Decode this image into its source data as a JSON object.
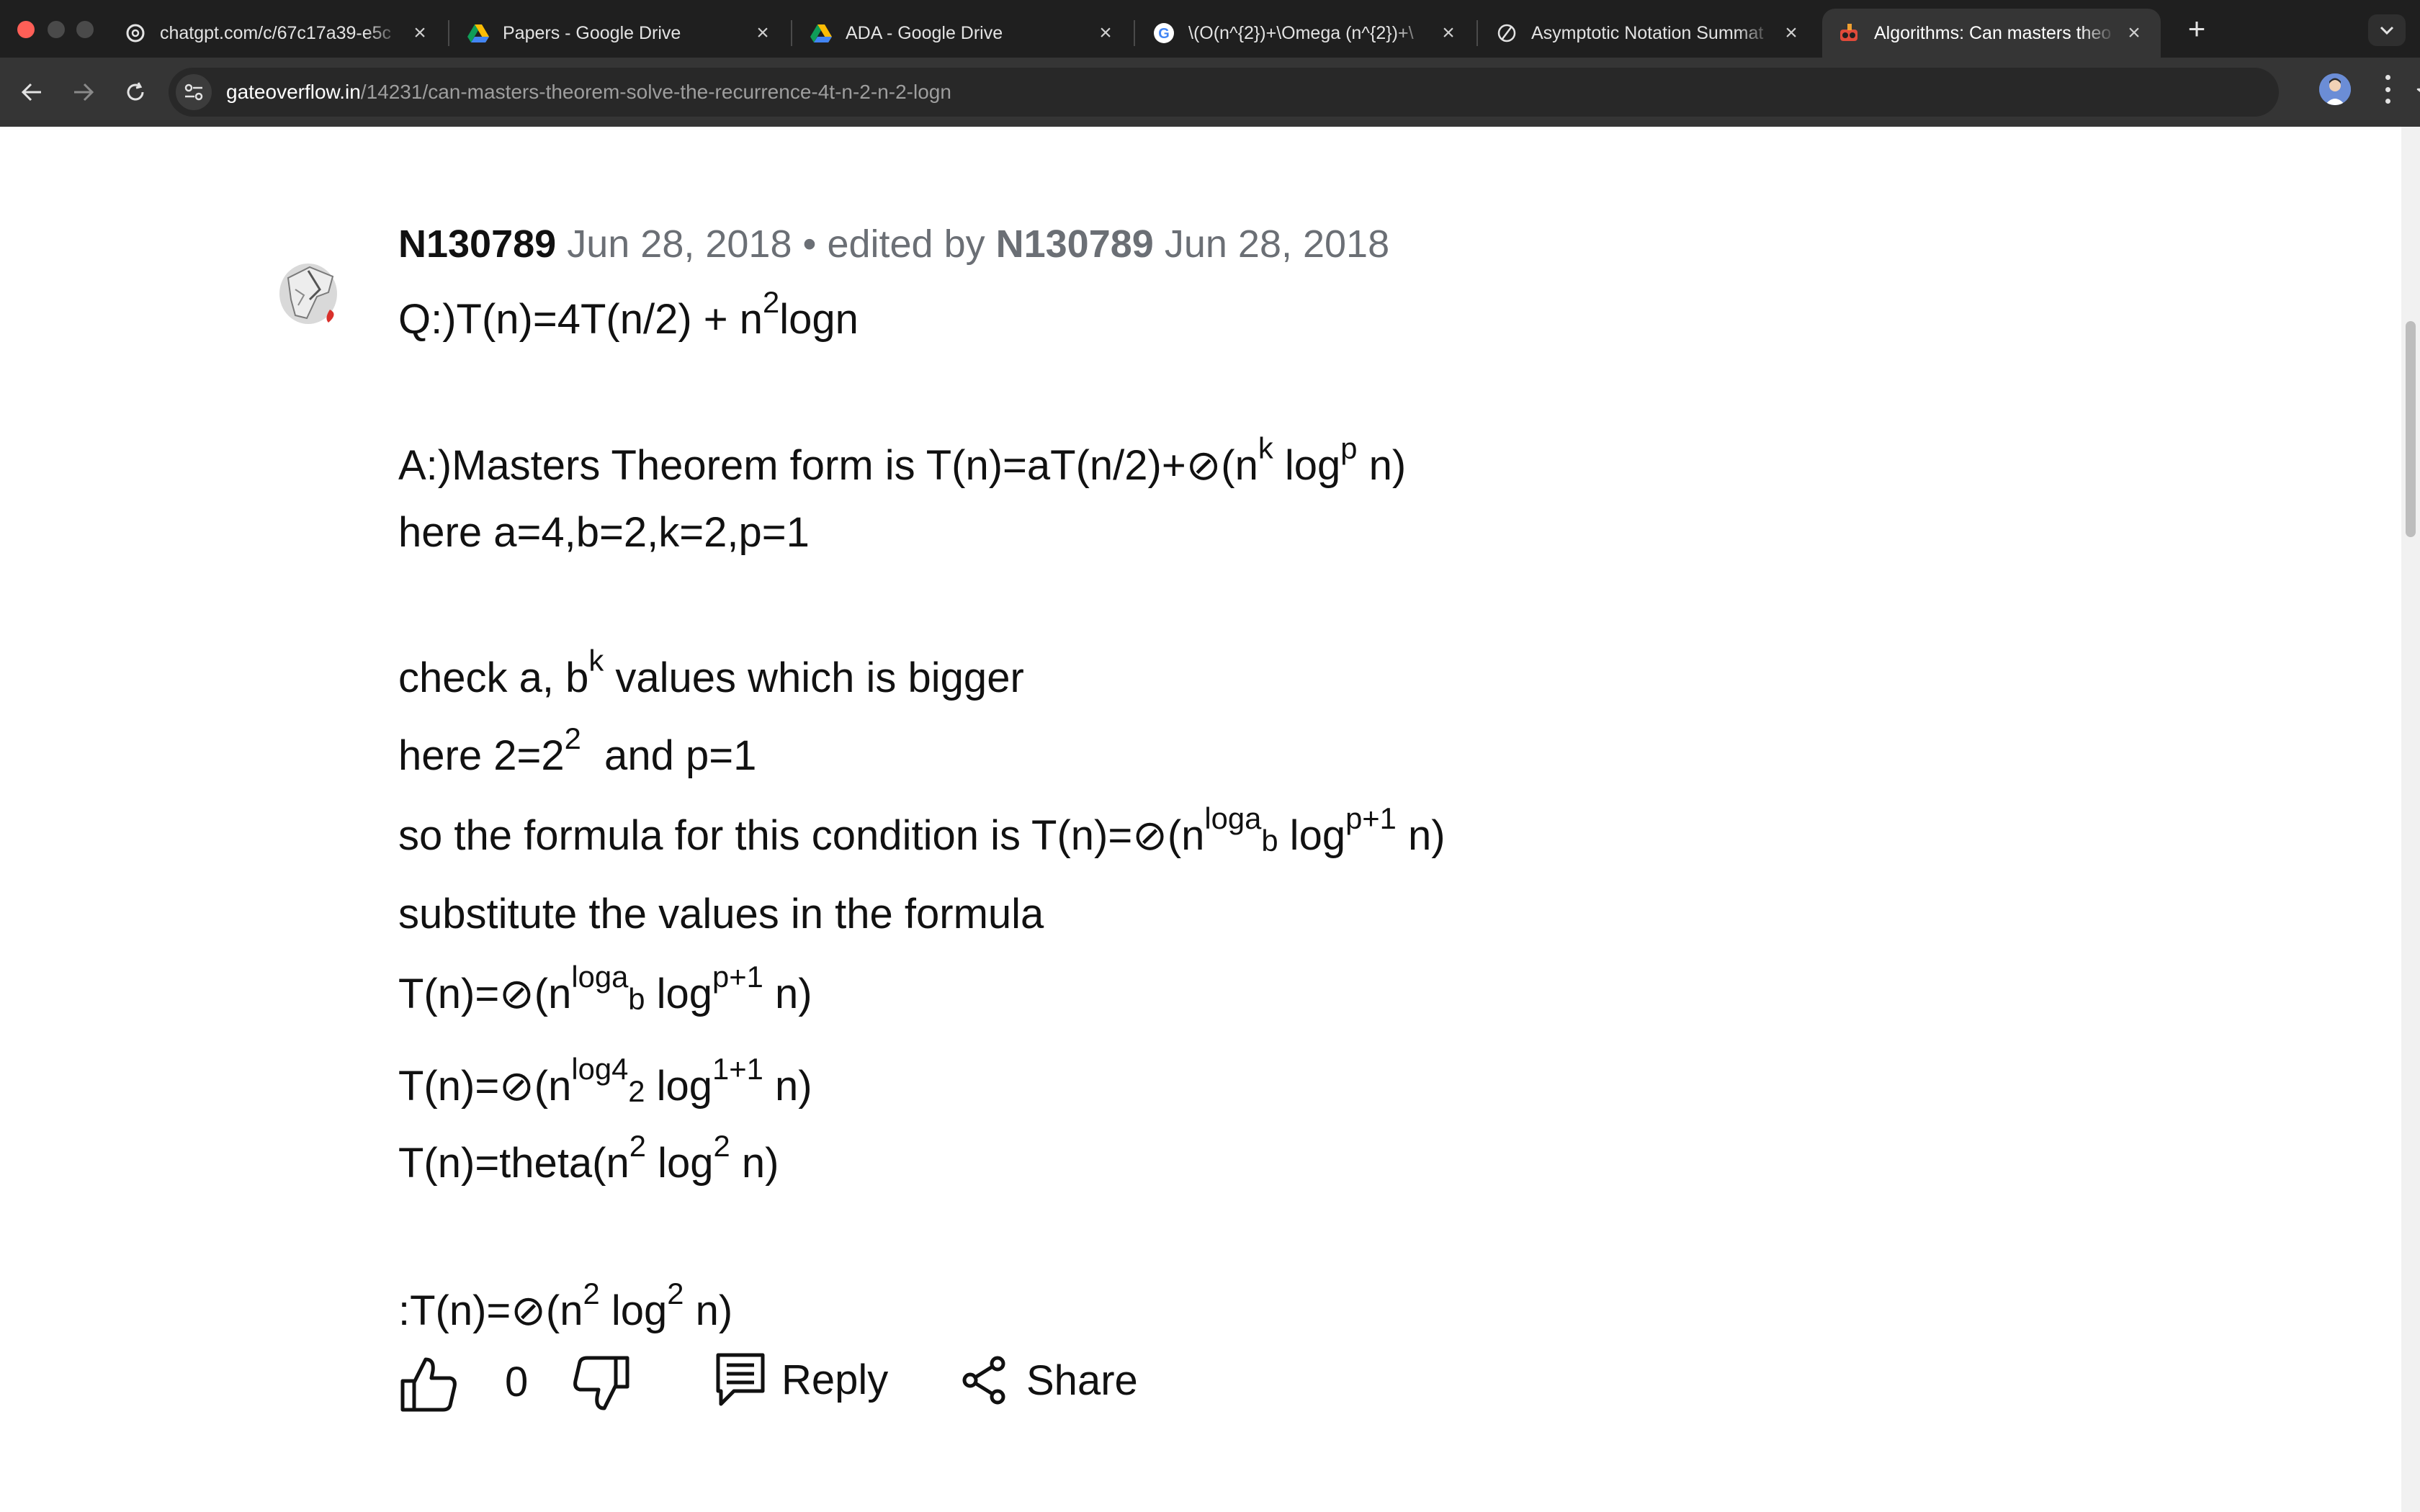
{
  "browser": {
    "tabs": [
      {
        "title": "chatgpt.com/c/67c17a39-e5c",
        "icon": "chatgpt-icon",
        "active": false
      },
      {
        "title": "Papers - Google Drive",
        "icon": "google-drive-icon",
        "active": false
      },
      {
        "title": "ADA - Google Drive",
        "icon": "google-drive-icon",
        "active": false
      },
      {
        "title": "\\(O(n^{2})+\\Omega (n^{2})+\\",
        "icon": "google-icon",
        "active": false
      },
      {
        "title": "Asymptotic Notation Summat",
        "icon": "perplexity-icon",
        "active": false
      },
      {
        "title": "Algorithms: Can masters theo",
        "icon": "gateoverflow-icon",
        "active": true
      }
    ],
    "new_tab_label": "+",
    "address": {
      "host": "gateoverflow.in",
      "path": "/14231/can-masters-theorem-solve-the-recurrence-4t-n-2-n-2-logn"
    }
  },
  "post": {
    "author": "N130789",
    "date": "Jun 28, 2018",
    "edited_separator": "•",
    "edited_by_label": "edited by",
    "editor": "N130789",
    "edited_date": "Jun 28, 2018",
    "lines": {
      "q_pre": "Q:)T(n)=4T(n/2) + n",
      "q_sup": "2",
      "q_post": "logn",
      "a1_pre": "A:)Masters Theorem form is T(n)=aT(n/2)+⊘(n",
      "a1_sup1": "k",
      "a1_mid": " log",
      "a1_sup2": "p",
      "a1_post": " n)",
      "a2": "here a=4,b=2,k=2,p=1",
      "c1_pre": "check a, b",
      "c1_sup": "k",
      "c1_post": " values which is bigger",
      "h_pre": "here 2=2",
      "h_sup": "2",
      "h_post": "  and p=1",
      "f_pre": "so the formula for this condition is T(n)=⊘(n",
      "f_sup": "loga",
      "f_sub": "b",
      "f_mid": " log",
      "f_sup2": "p+1",
      "f_post": " n)",
      "s": "substitute the values in the formula",
      "t1_pre": "T(n)=⊘(n",
      "t1_sup": "loga",
      "t1_sub": "b",
      "t1_mid": " log",
      "t1_sup2": "p+1",
      "t1_post": " n)",
      "t2_pre": "T(n)=⊘(n",
      "t2_sup": "log4",
      "t2_sub": "2",
      "t2_mid": " log",
      "t2_sup2": "1+1",
      "t2_post": " n)",
      "t3_pre": "T(n)=theta(n",
      "t3_sup": "2",
      "t3_mid": " log",
      "t3_sup2": "2",
      "t3_post": " n)",
      "r_pre": ":T(n)=⊘(n",
      "r_sup": "2",
      "r_mid": " log",
      "r_sup2": "2",
      "r_post": " n)"
    },
    "vote_count": "0",
    "reply_label": "Reply",
    "share_label": "Share"
  }
}
